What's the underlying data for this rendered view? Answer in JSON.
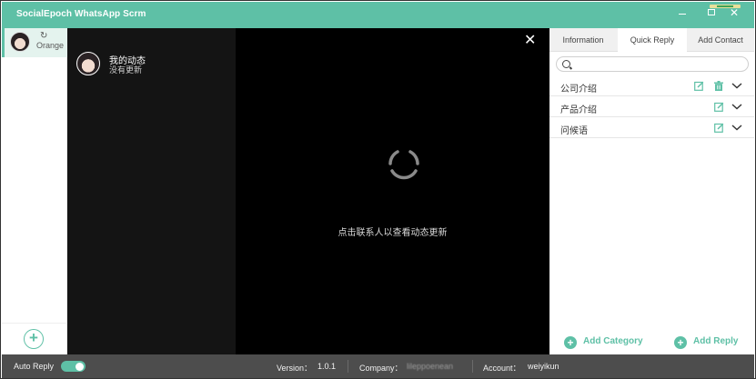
{
  "app": {
    "title": "SocialEpoch WhatsApp Scrm"
  },
  "rail": {
    "account_name": "Orange"
  },
  "status_list": {
    "my_status_title": "我的动态",
    "my_status_subtitle": "没有更新"
  },
  "viewer": {
    "hint": "点击联系人以查看动态更新"
  },
  "right_panel": {
    "tabs": [
      {
        "label": "Information"
      },
      {
        "label": "Quick Reply"
      },
      {
        "label": "Add Contact"
      }
    ],
    "active_tab": "Quick Reply",
    "search_placeholder": "",
    "quick_reply_categories": [
      {
        "label": "公司介绍"
      },
      {
        "label": "产品介绍"
      },
      {
        "label": "问候语"
      }
    ],
    "add_category_label": "Add Category",
    "add_reply_label": "Add Reply"
  },
  "statusbar": {
    "auto_reply_label": "Auto Reply",
    "auto_reply_enabled": true,
    "version_label": "Version：",
    "version_value": "1.0.1",
    "company_label": "Company：",
    "company_value": "lileppoenean",
    "account_label": "Account：",
    "account_value": "weiyikun"
  },
  "colors": {
    "accent": "#5ec0a6",
    "dark_panel": "#141414",
    "statusbar_bg": "#4d4d4d"
  }
}
